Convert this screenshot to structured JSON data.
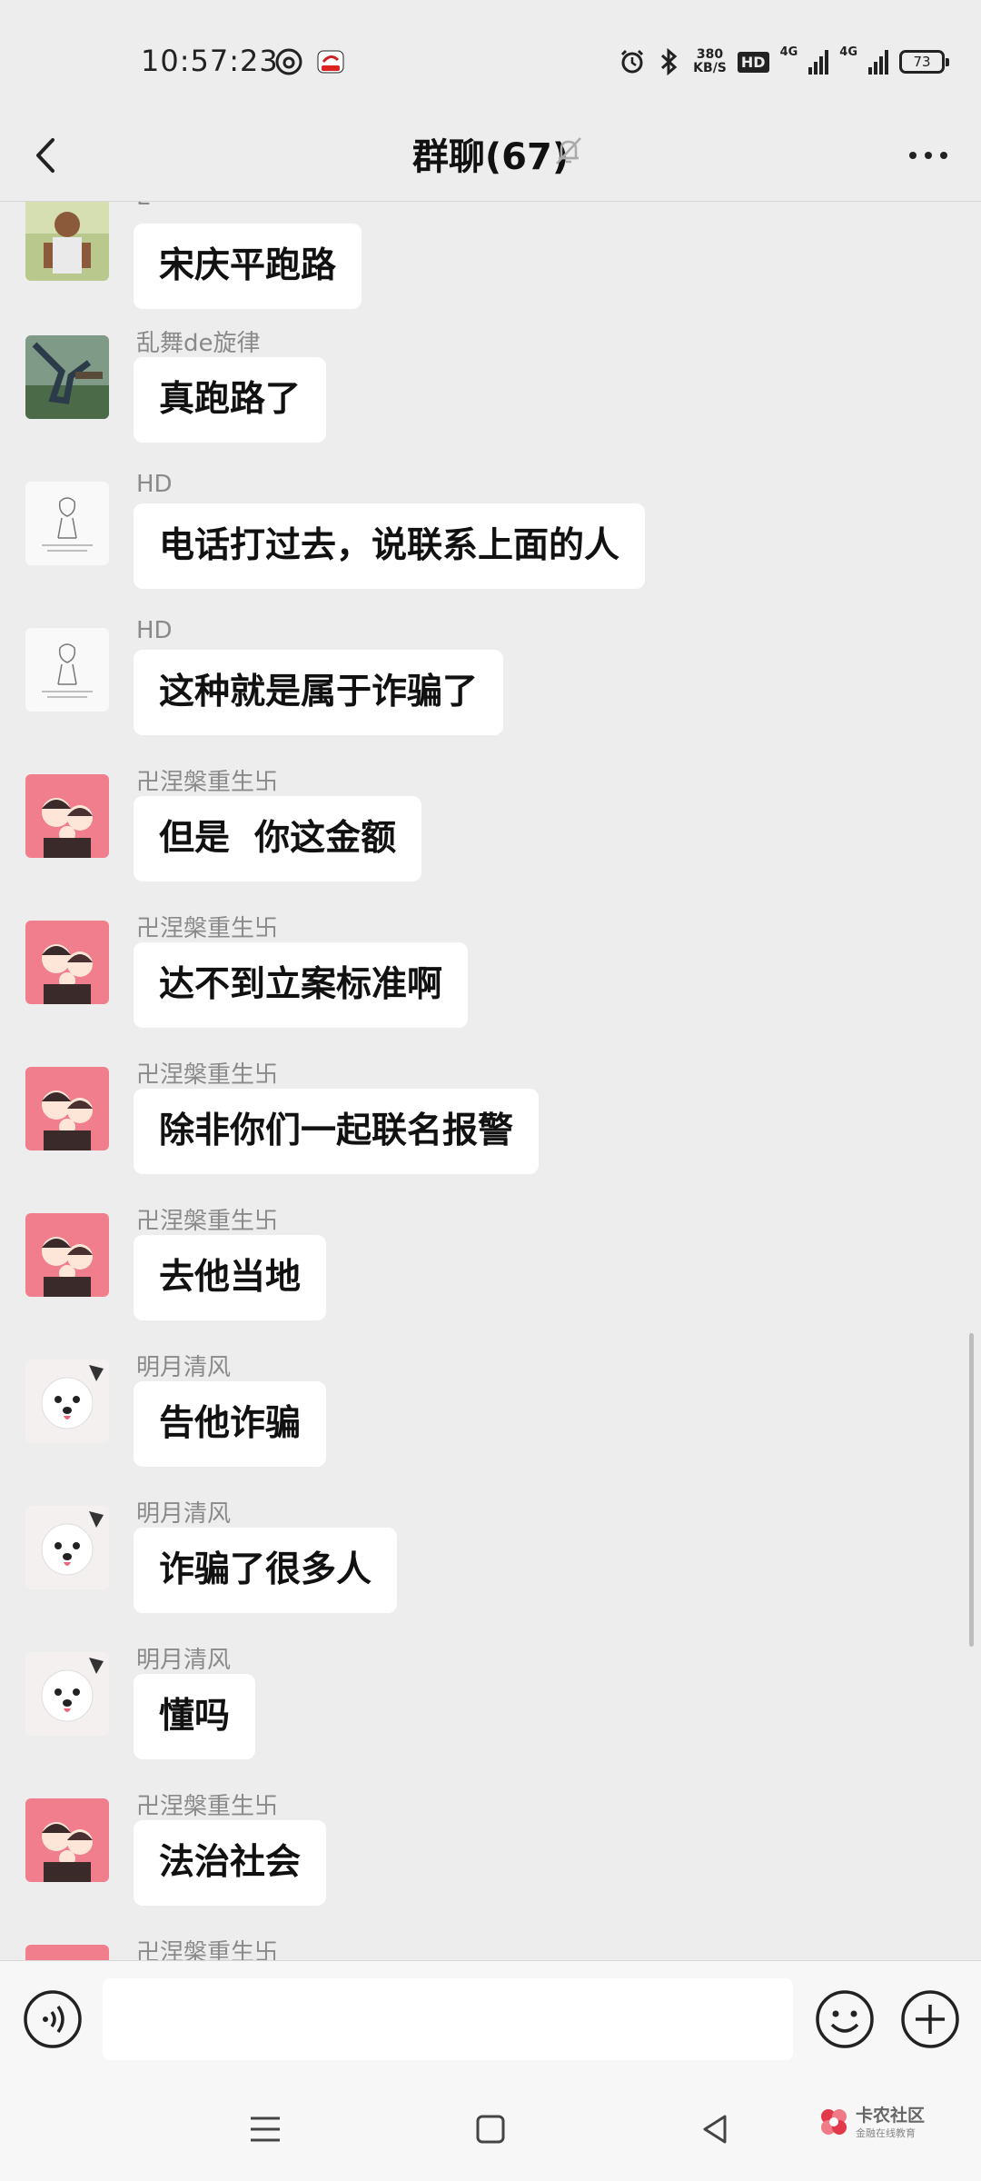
{
  "status_bar": {
    "time": "10:57:23",
    "net_speed": "380",
    "net_unit": "KB/S",
    "hd_label": "HD",
    "net_4g_a": "4G",
    "net_4g_b": "4G",
    "battery": "73"
  },
  "title_bar": {
    "title": "群聊(67)",
    "icons": [
      "back-icon",
      "mute-bell-icon",
      "more-icon"
    ]
  },
  "messages": [
    {
      "sender": "L",
      "text": "宋庆平跑路",
      "avatar": "man-photo"
    },
    {
      "sender": "乱舞de旋律",
      "text": "真跑路了",
      "avatar": "robot-scene"
    },
    {
      "sender": "HD",
      "text": "电话打过去，说联系上面的人",
      "avatar": "sketch-drawing"
    },
    {
      "sender": "HD",
      "text": "这种就是属于诈骗了",
      "avatar": "sketch-drawing"
    },
    {
      "sender": "卍涅槃重生卐",
      "text": "但是  你这金额",
      "avatar": "cartoon-couple"
    },
    {
      "sender": "卍涅槃重生卐",
      "text": "达不到立案标准啊",
      "avatar": "cartoon-couple"
    },
    {
      "sender": "卍涅槃重生卐",
      "text": "除非你们一起联名报警",
      "avatar": "cartoon-couple"
    },
    {
      "sender": "卍涅槃重生卐",
      "text": "去他当地",
      "avatar": "cartoon-couple"
    },
    {
      "sender": "明月清风",
      "text": "告他诈骗",
      "avatar": "white-dog"
    },
    {
      "sender": "明月清风",
      "text": "诈骗了很多人",
      "avatar": "white-dog"
    },
    {
      "sender": "明月清风",
      "text": "懂吗",
      "avatar": "white-dog"
    },
    {
      "sender": "卍涅槃重生卐",
      "text": "法治社会",
      "avatar": "cartoon-couple"
    },
    {
      "sender": "卍涅槃重生卐",
      "text": "",
      "avatar": "cartoon-couple"
    }
  ],
  "input_bar": {
    "placeholder": "",
    "icons": [
      "voice-icon",
      "emoji-icon",
      "plus-icon"
    ]
  },
  "nav_bar": {
    "icons": [
      "menu-icon",
      "home-icon",
      "back-triangle-icon"
    ]
  },
  "watermark": {
    "text": "卡农社区",
    "subtext": "金融在线教育"
  },
  "colors": {
    "background": "#ededed",
    "bubble": "#ffffff",
    "sender": "#8a8a8a",
    "avatar_pink": "#f07e8c"
  }
}
